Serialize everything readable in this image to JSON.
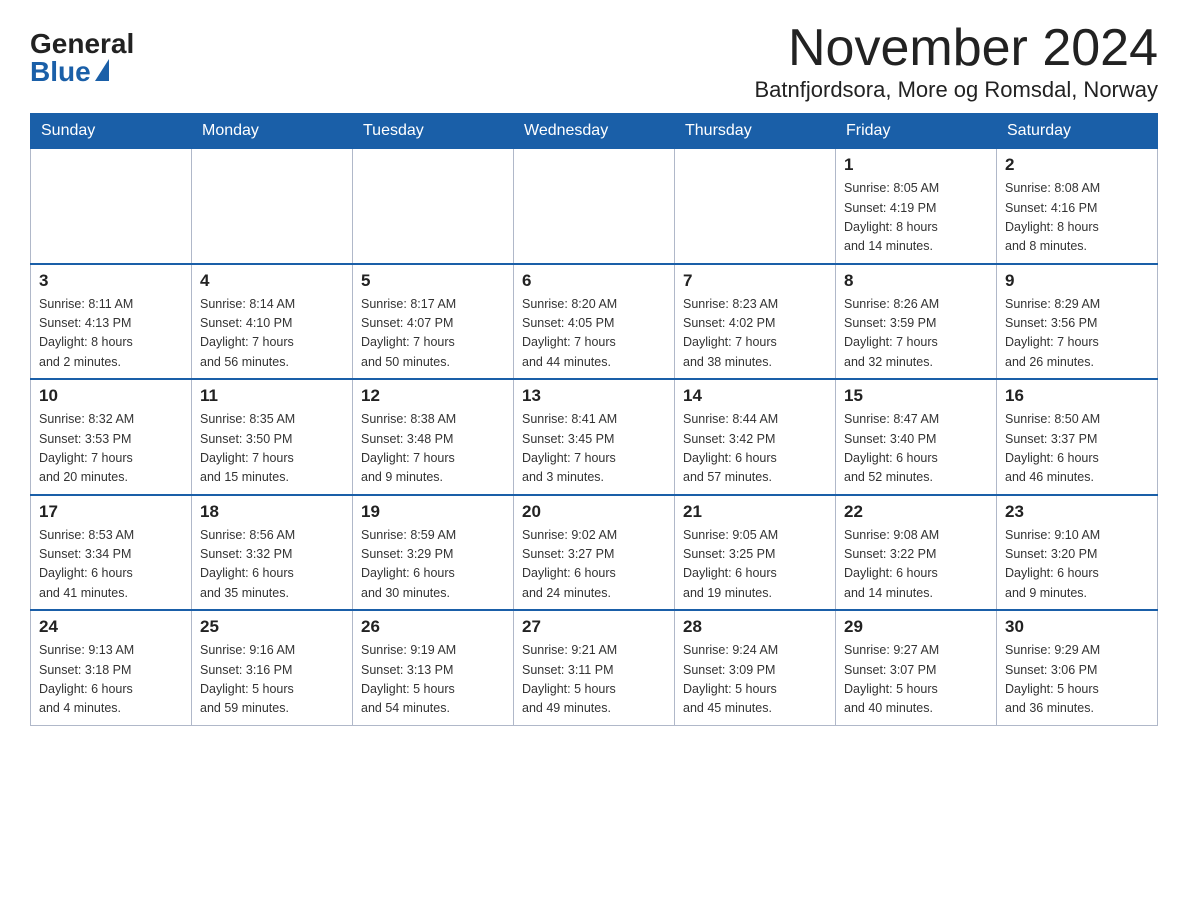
{
  "logo": {
    "general": "General",
    "blue": "Blue"
  },
  "header": {
    "month": "November 2024",
    "location": "Batnfjordsora, More og Romsdal, Norway"
  },
  "weekdays": [
    "Sunday",
    "Monday",
    "Tuesday",
    "Wednesday",
    "Thursday",
    "Friday",
    "Saturday"
  ],
  "weeks": [
    [
      {
        "day": "",
        "info": ""
      },
      {
        "day": "",
        "info": ""
      },
      {
        "day": "",
        "info": ""
      },
      {
        "day": "",
        "info": ""
      },
      {
        "day": "",
        "info": ""
      },
      {
        "day": "1",
        "info": "Sunrise: 8:05 AM\nSunset: 4:19 PM\nDaylight: 8 hours\nand 14 minutes."
      },
      {
        "day": "2",
        "info": "Sunrise: 8:08 AM\nSunset: 4:16 PM\nDaylight: 8 hours\nand 8 minutes."
      }
    ],
    [
      {
        "day": "3",
        "info": "Sunrise: 8:11 AM\nSunset: 4:13 PM\nDaylight: 8 hours\nand 2 minutes."
      },
      {
        "day": "4",
        "info": "Sunrise: 8:14 AM\nSunset: 4:10 PM\nDaylight: 7 hours\nand 56 minutes."
      },
      {
        "day": "5",
        "info": "Sunrise: 8:17 AM\nSunset: 4:07 PM\nDaylight: 7 hours\nand 50 minutes."
      },
      {
        "day": "6",
        "info": "Sunrise: 8:20 AM\nSunset: 4:05 PM\nDaylight: 7 hours\nand 44 minutes."
      },
      {
        "day": "7",
        "info": "Sunrise: 8:23 AM\nSunset: 4:02 PM\nDaylight: 7 hours\nand 38 minutes."
      },
      {
        "day": "8",
        "info": "Sunrise: 8:26 AM\nSunset: 3:59 PM\nDaylight: 7 hours\nand 32 minutes."
      },
      {
        "day": "9",
        "info": "Sunrise: 8:29 AM\nSunset: 3:56 PM\nDaylight: 7 hours\nand 26 minutes."
      }
    ],
    [
      {
        "day": "10",
        "info": "Sunrise: 8:32 AM\nSunset: 3:53 PM\nDaylight: 7 hours\nand 20 minutes."
      },
      {
        "day": "11",
        "info": "Sunrise: 8:35 AM\nSunset: 3:50 PM\nDaylight: 7 hours\nand 15 minutes."
      },
      {
        "day": "12",
        "info": "Sunrise: 8:38 AM\nSunset: 3:48 PM\nDaylight: 7 hours\nand 9 minutes."
      },
      {
        "day": "13",
        "info": "Sunrise: 8:41 AM\nSunset: 3:45 PM\nDaylight: 7 hours\nand 3 minutes."
      },
      {
        "day": "14",
        "info": "Sunrise: 8:44 AM\nSunset: 3:42 PM\nDaylight: 6 hours\nand 57 minutes."
      },
      {
        "day": "15",
        "info": "Sunrise: 8:47 AM\nSunset: 3:40 PM\nDaylight: 6 hours\nand 52 minutes."
      },
      {
        "day": "16",
        "info": "Sunrise: 8:50 AM\nSunset: 3:37 PM\nDaylight: 6 hours\nand 46 minutes."
      }
    ],
    [
      {
        "day": "17",
        "info": "Sunrise: 8:53 AM\nSunset: 3:34 PM\nDaylight: 6 hours\nand 41 minutes."
      },
      {
        "day": "18",
        "info": "Sunrise: 8:56 AM\nSunset: 3:32 PM\nDaylight: 6 hours\nand 35 minutes."
      },
      {
        "day": "19",
        "info": "Sunrise: 8:59 AM\nSunset: 3:29 PM\nDaylight: 6 hours\nand 30 minutes."
      },
      {
        "day": "20",
        "info": "Sunrise: 9:02 AM\nSunset: 3:27 PM\nDaylight: 6 hours\nand 24 minutes."
      },
      {
        "day": "21",
        "info": "Sunrise: 9:05 AM\nSunset: 3:25 PM\nDaylight: 6 hours\nand 19 minutes."
      },
      {
        "day": "22",
        "info": "Sunrise: 9:08 AM\nSunset: 3:22 PM\nDaylight: 6 hours\nand 14 minutes."
      },
      {
        "day": "23",
        "info": "Sunrise: 9:10 AM\nSunset: 3:20 PM\nDaylight: 6 hours\nand 9 minutes."
      }
    ],
    [
      {
        "day": "24",
        "info": "Sunrise: 9:13 AM\nSunset: 3:18 PM\nDaylight: 6 hours\nand 4 minutes."
      },
      {
        "day": "25",
        "info": "Sunrise: 9:16 AM\nSunset: 3:16 PM\nDaylight: 5 hours\nand 59 minutes."
      },
      {
        "day": "26",
        "info": "Sunrise: 9:19 AM\nSunset: 3:13 PM\nDaylight: 5 hours\nand 54 minutes."
      },
      {
        "day": "27",
        "info": "Sunrise: 9:21 AM\nSunset: 3:11 PM\nDaylight: 5 hours\nand 49 minutes."
      },
      {
        "day": "28",
        "info": "Sunrise: 9:24 AM\nSunset: 3:09 PM\nDaylight: 5 hours\nand 45 minutes."
      },
      {
        "day": "29",
        "info": "Sunrise: 9:27 AM\nSunset: 3:07 PM\nDaylight: 5 hours\nand 40 minutes."
      },
      {
        "day": "30",
        "info": "Sunrise: 9:29 AM\nSunset: 3:06 PM\nDaylight: 5 hours\nand 36 minutes."
      }
    ]
  ]
}
